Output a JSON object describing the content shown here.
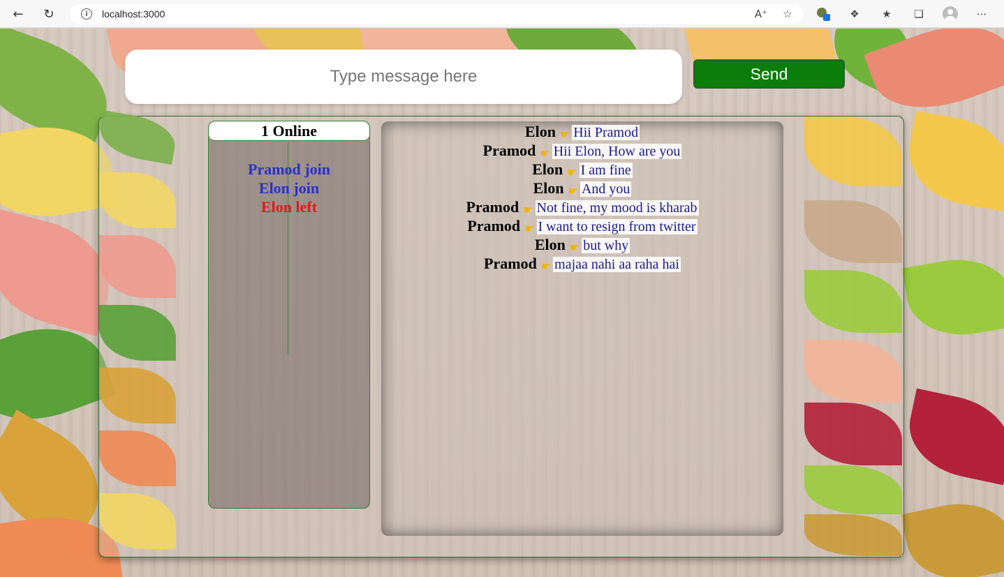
{
  "browser": {
    "url": "localhost:3000",
    "icons": [
      "back-arrow-icon",
      "reload-icon",
      "info-icon",
      "read-aloud-icon",
      "favorite-add-icon",
      "extension-icon",
      "puzzle-icon",
      "favorites-icon",
      "collections-icon",
      "profile-icon",
      "more-icon"
    ]
  },
  "composer": {
    "placeholder": "Type message here",
    "send_label": "Send"
  },
  "online": {
    "header": "1 Online",
    "activity": [
      {
        "text": "Pramod join",
        "type": "join"
      },
      {
        "text": "Elon join",
        "type": "join"
      },
      {
        "text": "Elon left",
        "type": "left"
      }
    ]
  },
  "chat": {
    "messages": [
      {
        "sender": "Elon",
        "text": "Hii Pramod"
      },
      {
        "sender": "Pramod",
        "text": "Hii Elon, How are you"
      },
      {
        "sender": "Elon",
        "text": "I am fine"
      },
      {
        "sender": "Elon",
        "text": "And you"
      },
      {
        "sender": "Pramod",
        "text": "Not fine, my mood is kharab"
      },
      {
        "sender": "Pramod",
        "text": "I want to resign from twitter"
      },
      {
        "sender": "Elon",
        "text": "but why"
      },
      {
        "sender": "Pramod",
        "text": "majaa nahi aa raha hai"
      }
    ]
  },
  "colors": {
    "send_button": "#0a7d0a",
    "join_text": "#2a2fcf",
    "left_text": "#e01a1a",
    "message_text": "#1a1a8a",
    "panel_border": "#2f6b2f"
  }
}
